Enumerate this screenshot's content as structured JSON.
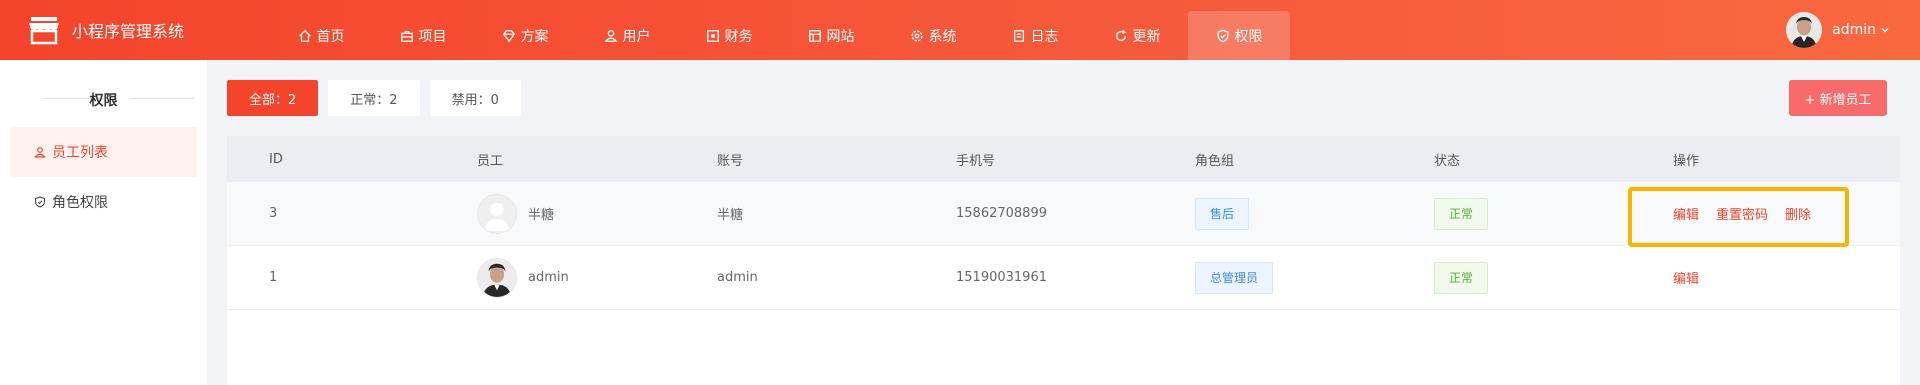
{
  "header": {
    "app_name": "小程序管理系统",
    "nav": [
      {
        "label": "首页",
        "icon": "home-icon"
      },
      {
        "label": "项目",
        "icon": "briefcase-icon"
      },
      {
        "label": "方案",
        "icon": "diamond-icon"
      },
      {
        "label": "用户",
        "icon": "user-icon"
      },
      {
        "label": "财务",
        "icon": "wallet-icon"
      },
      {
        "label": "网站",
        "icon": "window-icon"
      },
      {
        "label": "系统",
        "icon": "gear-icon"
      },
      {
        "label": "日志",
        "icon": "log-icon"
      },
      {
        "label": "更新",
        "icon": "refresh-icon"
      },
      {
        "label": "权限",
        "icon": "shield-icon"
      }
    ],
    "active_nav": "权限",
    "user_name": "admin"
  },
  "sidebar": {
    "title": "权限",
    "items": [
      {
        "label": "员工列表",
        "icon": "user-icon",
        "active": true
      },
      {
        "label": "角色权限",
        "icon": "shield-icon",
        "active": false
      }
    ]
  },
  "filters": [
    {
      "label": "全部：2",
      "active": true
    },
    {
      "label": "正常：2",
      "active": false
    },
    {
      "label": "禁用：0",
      "active": false
    }
  ],
  "add_button": "+ 新增员工",
  "table": {
    "columns": [
      "ID",
      "员工",
      "账号",
      "手机号",
      "角色组",
      "状态",
      "操作"
    ],
    "rows": [
      {
        "id": "3",
        "name": "半糖",
        "account": "半糖",
        "phone": "15862708899",
        "role": "售后",
        "status": "正常",
        "actions": [
          "编辑",
          "重置密码",
          "删除"
        ]
      },
      {
        "id": "1",
        "name": "admin",
        "account": "admin",
        "phone": "15190031961",
        "role": "总管理员",
        "status": "正常",
        "actions": [
          "编辑"
        ]
      }
    ]
  },
  "colors": {
    "brand": "#f4442c",
    "highlight": "#f7b500",
    "tag_blue": "#3a8ee6",
    "tag_green": "#58b039"
  }
}
